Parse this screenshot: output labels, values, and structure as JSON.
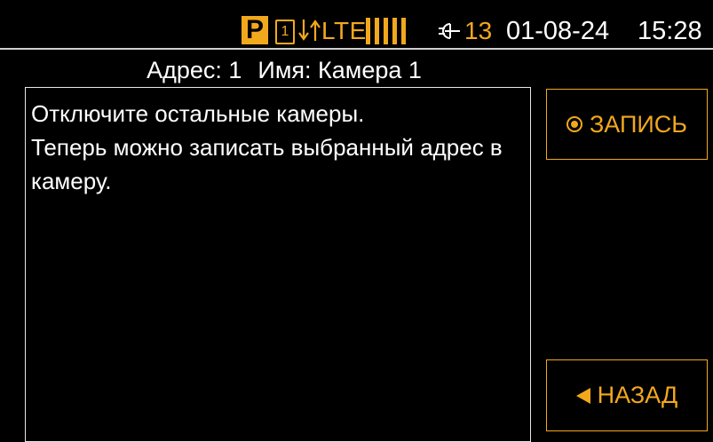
{
  "status_bar": {
    "mode_badge": "P",
    "sim_slot": "1",
    "network_type": "LTE",
    "signal_level": 1.0,
    "battery_count": "13",
    "date": "01-08-24",
    "time": "15:28",
    "icons": [
      "mode-p-icon",
      "sim-card-icon",
      "network-arrows-icon",
      "signal-bars-icon",
      "plug-icon"
    ],
    "accent_color": "#f2a81d"
  },
  "header": {
    "address_label": "Адрес: 1",
    "name_label": "Имя: Камера 1"
  },
  "message": {
    "lines": [
      "Отключите остальные камеры.",
      "Теперь можно записать выбранный адрес в",
      "камеру."
    ]
  },
  "buttons": {
    "record_label": "ЗАПИСЬ",
    "back_label": "НАЗАД"
  }
}
